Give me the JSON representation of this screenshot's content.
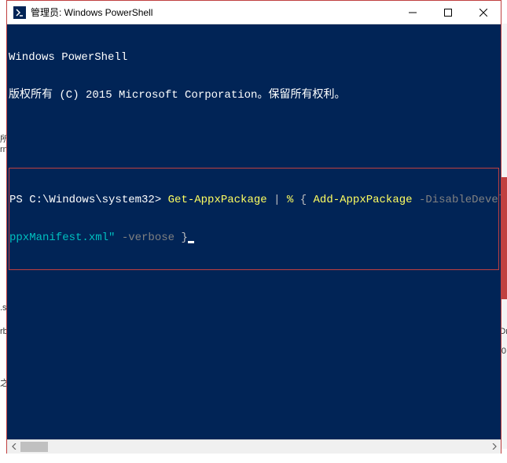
{
  "titlebar": {
    "title": "管理员: Windows PowerShell"
  },
  "terminal": {
    "header_line1": "Windows PowerShell",
    "header_line2": "版权所有 (C) 2015 Microsoft Corporation。保留所有权利。",
    "prompt": "PS C:\\Windows\\system32>",
    "cmd_get": "Get-AppxPackage",
    "cmd_pipe": "|",
    "cmd_alias": "%",
    "cmd_brace_open": "{",
    "cmd_add": "Add-AppxPackage",
    "cmd_param1": "-DisableDevelo",
    "cmd_xml": "ppxManifest.xml\"",
    "cmd_param2": "-verbose",
    "cmd_brace_close": "}"
  },
  "bg": {
    "t1": "所",
    "t2": "rn",
    "t3": ".s",
    "t4": "rb",
    "t5": "之",
    "t6": "Dr",
    "t7": "0"
  }
}
